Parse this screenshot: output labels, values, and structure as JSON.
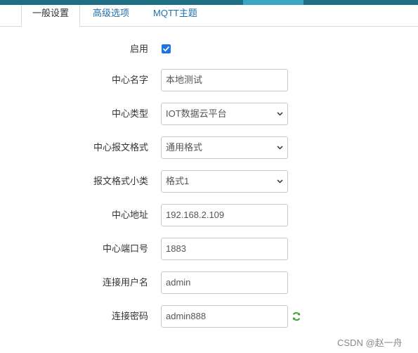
{
  "tabs": [
    {
      "label": "一般设置",
      "active": true
    },
    {
      "label": "高级选项",
      "active": false
    },
    {
      "label": "MQTT主题",
      "active": false
    }
  ],
  "form": {
    "enable": {
      "label": "启用",
      "checked": true
    },
    "center_name": {
      "label": "中心名字",
      "value": "本地测试"
    },
    "center_type": {
      "label": "中心类型",
      "value": "IOT数据云平台"
    },
    "report_format": {
      "label": "中心报文格式",
      "value": "通用格式"
    },
    "format_subtype": {
      "label": "报文格式小类",
      "value": "格式1"
    },
    "center_address": {
      "label": "中心地址",
      "value": "192.168.2.109"
    },
    "center_port": {
      "label": "中心端口号",
      "value": "1883"
    },
    "username": {
      "label": "连接用户名",
      "value": "admin"
    },
    "password": {
      "label": "连接密码",
      "value": "admin888"
    }
  },
  "watermark": "CSDN @赵一舟",
  "colors": {
    "accent": "#1a73e8",
    "header": "#1e6f83",
    "refresh": "#3fa535"
  }
}
